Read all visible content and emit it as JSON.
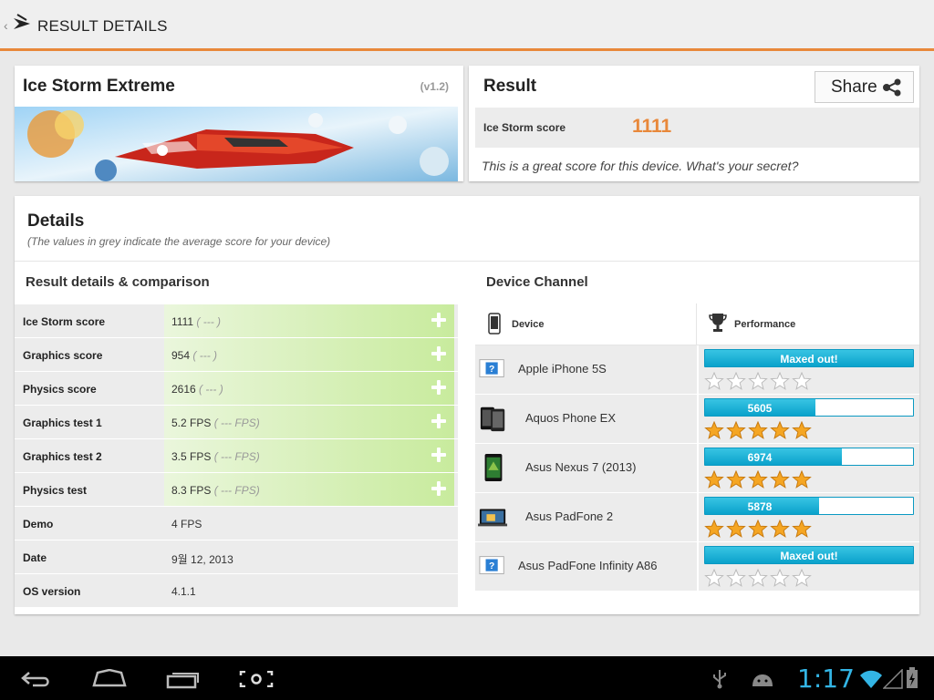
{
  "action_bar": {
    "title": "RESULT DETAILS",
    "up_glyph": "‹",
    "logo_icon": "3dmark-logo-icon"
  },
  "test": {
    "name": "Ice Storm Extreme",
    "version": "(v1.2)"
  },
  "result": {
    "title": "Result",
    "share_label": "Share",
    "score_label": "Ice Storm score",
    "score_value": "1111",
    "message": "This is a great score for this device. What's your secret?"
  },
  "details": {
    "title": "Details",
    "subtitle": "(The values in grey indicate the average score for your device)",
    "comparison_heading": "Result details & comparison",
    "device_heading": "Device Channel",
    "rows": [
      {
        "label": "Ice Storm score",
        "value": "1111",
        "avg": "( --- )",
        "expandable": true
      },
      {
        "label": "Graphics score",
        "value": "954",
        "avg": "( --- )",
        "expandable": true
      },
      {
        "label": "Physics score",
        "value": "2616",
        "avg": "( --- )",
        "expandable": true
      },
      {
        "label": "Graphics test 1",
        "value": "5.2 FPS",
        "avg": "( --- FPS)",
        "expandable": true
      },
      {
        "label": "Graphics test 2",
        "value": "3.5 FPS",
        "avg": "( --- FPS)",
        "expandable": true
      },
      {
        "label": "Physics test",
        "value": "8.3 FPS",
        "avg": "( --- FPS)",
        "expandable": true
      },
      {
        "label": "Demo",
        "value": "4 FPS",
        "avg": "",
        "expandable": false
      },
      {
        "label": "Date",
        "value": "9월 12, 2013",
        "avg": "",
        "expandable": false
      },
      {
        "label": "OS version",
        "value": "4.1.1",
        "avg": "",
        "expandable": false
      }
    ],
    "device_table": {
      "col_device": "Device",
      "col_performance": "Performance",
      "devices": [
        {
          "name": "Apple iPhone 5S",
          "bar_text": "Maxed out!",
          "fraction": 1.0,
          "maxed": true,
          "stars": 0,
          "thumb": "unknown"
        },
        {
          "name": "Aquos Phone EX",
          "bar_text": "5605",
          "fraction": 0.53,
          "maxed": false,
          "stars": 5,
          "thumb": "phone"
        },
        {
          "name": "Asus Nexus 7 (2013)",
          "bar_text": "6974",
          "fraction": 0.66,
          "maxed": false,
          "stars": 5,
          "thumb": "tablet"
        },
        {
          "name": "Asus PadFone 2",
          "bar_text": "5878",
          "fraction": 0.55,
          "maxed": false,
          "stars": 5,
          "thumb": "padfone"
        },
        {
          "name": "Asus PadFone Infinity A86",
          "bar_text": "Maxed out!",
          "fraction": 1.0,
          "maxed": true,
          "stars": 0,
          "thumb": "unknown"
        }
      ]
    }
  },
  "status_bar": {
    "time": "1:17"
  },
  "colors": {
    "accent": "#e8883a",
    "bar": "#0aa2cb",
    "clock": "#33b5e5",
    "star": "#f5a623"
  }
}
